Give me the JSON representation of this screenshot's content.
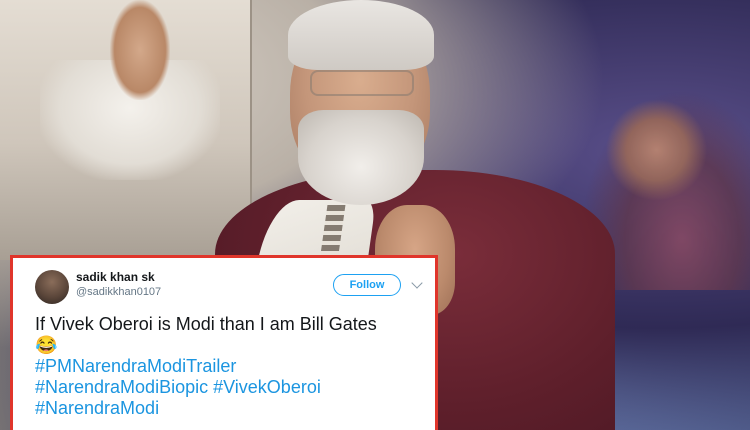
{
  "tweet": {
    "display_name": "sadik khan sk",
    "handle": "@sadikkhan0107",
    "follow_label": "Follow",
    "text": "If Vivek Oberoi is Modi than I am Bill Gates",
    "emoji": "😂",
    "hashtags": [
      "#PMNarendraModiTrailer",
      "#NarendraModiBiopic",
      "#VivekOberoi",
      "#NarendraModi"
    ]
  },
  "colors": {
    "card_border": "#e0352b",
    "hashtag_blue": "#1b95e0",
    "follow_blue": "#1da1f2"
  },
  "icons": {
    "menu": "chevron-down-icon",
    "emoji": "face-with-tears-of-joy-icon"
  }
}
